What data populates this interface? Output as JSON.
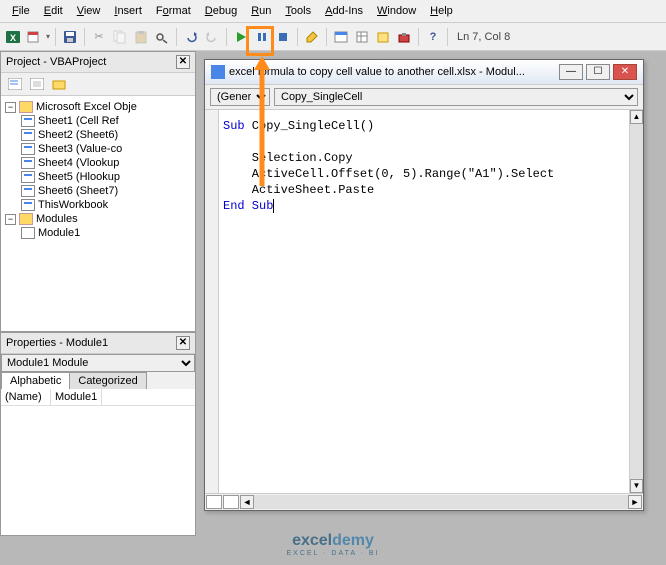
{
  "menu": [
    "File",
    "Edit",
    "View",
    "Insert",
    "Format",
    "Debug",
    "Run",
    "Tools",
    "Add-Ins",
    "Window",
    "Help"
  ],
  "status": "Ln 7, Col 8",
  "project": {
    "title": "Project - VBAProject",
    "root": "Microsoft Excel Obje",
    "sheets": [
      "Sheet1 (Cell Ref",
      "Sheet2 (Sheet6)",
      "Sheet3 (Value-co",
      "Sheet4 (Vlookup",
      "Sheet5 (Hlookup",
      "Sheet6 (Sheet7)",
      "ThisWorkbook"
    ],
    "modulesFolder": "Modules",
    "modules": [
      "Module1"
    ]
  },
  "props": {
    "title": "Properties - Module1",
    "selector": "Module1 Module",
    "tabs": [
      "Alphabetic",
      "Categorized"
    ],
    "rows": [
      [
        "(Name)",
        "Module1"
      ]
    ]
  },
  "codewin": {
    "title": "excel formula to copy cell value to another cell.xlsx - Modul...",
    "ddLeft": "(General)",
    "ddRight": "Copy_SingleCell",
    "code": {
      "l1a": "Sub",
      "l1b": " Copy_SingleCell()",
      "l2": "",
      "l3": "    Selection.Copy",
      "l4": "    ActiveCell.Offset(0, 5).Range(\"A1\").Select",
      "l5": "    ActiveSheet.Paste",
      "l6a": "End Sub"
    }
  },
  "logo": {
    "main1": "excel",
    "main2": "demy",
    "sub": "EXCEL · DATA · BI"
  }
}
